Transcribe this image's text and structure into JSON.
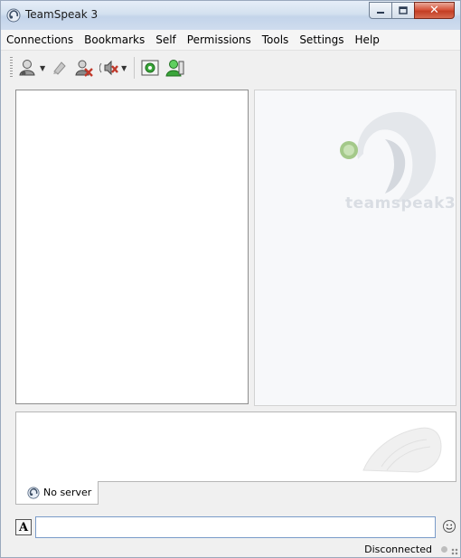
{
  "window": {
    "title": "TeamSpeak 3",
    "controls": {
      "minimize": "minimize",
      "maximize": "maximize",
      "close": "close"
    }
  },
  "menu": {
    "items": [
      "Connections",
      "Bookmarks",
      "Self",
      "Permissions",
      "Tools",
      "Settings",
      "Help"
    ]
  },
  "toolbar": {
    "buttons": [
      {
        "icon": "connect-icon",
        "has_dropdown": true
      },
      {
        "icon": "bookmark-icon",
        "has_dropdown": false
      },
      {
        "icon": "away-icon",
        "has_dropdown": false
      },
      {
        "icon": "mute-speaker-icon",
        "has_dropdown": true
      },
      {
        "icon": "subscribe-icon",
        "has_dropdown": false
      },
      {
        "icon": "identity-icon",
        "has_dropdown": false
      }
    ]
  },
  "logo": {
    "text": "teamspeak3"
  },
  "tabs": [
    {
      "label": "No server"
    }
  ],
  "chat": {
    "input_value": ""
  },
  "status": {
    "text": "Disconnected"
  },
  "colors": {
    "accent": "#3a6ea5",
    "close_red": "#c33e24",
    "status_dot": "#bdbdbd"
  }
}
